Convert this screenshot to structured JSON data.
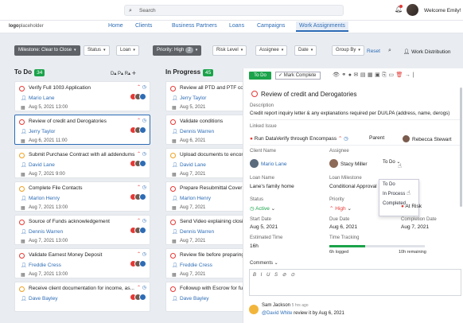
{
  "topbar": {
    "search_placeholder": "Search",
    "welcome": "Welcome Emily!"
  },
  "logo": {
    "brand": "logo",
    "rest": "placeholder"
  },
  "nav": [
    "Home",
    "Clients",
    "Business Partners",
    "Loans",
    "Campaigns",
    "Work Assignments"
  ],
  "filters": {
    "milestone": "Milestone: Clear to Close",
    "status": "Status",
    "loan": "Loan",
    "priority": "Priority: High",
    "priority_count": "2",
    "risk": "Risk Level",
    "assignee": "Assignee",
    "date": "Date",
    "group": "Group By",
    "reset": "Reset",
    "work_dist": "Work Distribution"
  },
  "todo": {
    "title": "To Do",
    "count": "34",
    "sort": "D▴  P▴  R▴"
  },
  "inprogress": {
    "title": "In Progress",
    "count": "45"
  },
  "todo_cards": [
    {
      "title": "Verify Full 1003 Application",
      "user": "Mario Lane",
      "date": "Aug 5, 2021  13:00",
      "ring": "r"
    },
    {
      "title": "Review of credit and Derogatories",
      "user": "Jerry Taylor",
      "date": "Aug 6, 2021  11:00",
      "ring": "r"
    },
    {
      "title": "Submit Purchase Contract with all addendums",
      "user": "David Lane",
      "date": "Aug 7, 2021  9:00",
      "ring": "o"
    },
    {
      "title": "Complete File Contacts",
      "user": "Marlon Henry",
      "date": "Aug 7, 2021  13:00",
      "ring": "o"
    },
    {
      "title": "Source of Funds acknowledgement",
      "user": "Dennis Warren",
      "date": "Aug 7, 2021  13:00",
      "ring": "r"
    },
    {
      "title": "Validate Earnest Money Deposit",
      "user": "Freddie Cress",
      "date": "Aug 7, 2021  13:00",
      "ring": "r"
    },
    {
      "title": "Receive client documentation for income, as...",
      "user": "Dave Bayley",
      "date": "",
      "ring": "o"
    }
  ],
  "progress_cards": [
    {
      "title": "Review all PTD and PTF condi...",
      "user": "Jerry Taylor",
      "date": "Aug 5, 2021",
      "ring": "r"
    },
    {
      "title": "Validate conditions",
      "user": "Dennis Warren",
      "date": "Aug 6, 2021",
      "ring": "r"
    },
    {
      "title": "Upload documents to encomp...",
      "user": "David Lane",
      "date": "Aug 7, 2021",
      "ring": "o"
    },
    {
      "title": "Prepare Resubmittal Cover Le...",
      "user": "Marlon Henry",
      "date": "Aug 7, 2021",
      "ring": "r"
    },
    {
      "title": "Send Video explaining closing...",
      "user": "Dennis Warren",
      "date": "Aug 7, 2021",
      "ring": "r"
    },
    {
      "title": "Review file before preparing...",
      "user": "Freddie Cress",
      "date": "Aug 7, 2021",
      "ring": "r"
    },
    {
      "title": "Followup with Escrow for funding",
      "user": "Dave Bayley",
      "date": "",
      "ring": "r"
    }
  ],
  "panel": {
    "status_btn": "To Do",
    "mark_complete": "Mark Complete",
    "title": "Review of credit and Derogatories",
    "desc_label": "Description",
    "desc": "Credit report inquiry letter & any explanations required per DU/LPA (address, name, derogs)",
    "linked_label": "Linked Issue",
    "linked": "Run DataVerify through Encompass",
    "parent_label": "Parent",
    "parent_user": "Rebecca Stewart",
    "client_label": "Client Name",
    "client": "Mario Lane",
    "assignee_label": "Assignee",
    "assignee": "Stacy Miller",
    "assignee_status": "To Do",
    "loan_label": "Loan Name",
    "loan": "Lane's family home",
    "milestone_label": "Loan Milestone",
    "milestone": "Conditional Approval",
    "status_label": "Status",
    "status": "Active",
    "priority_label": "Priority",
    "priority": "High",
    "risk": "At Risk",
    "start_label": "Start Date",
    "start": "Aug 5, 2021",
    "due_label": "Due Date",
    "due": "Aug 6, 2021",
    "completion_label": "Completion Date",
    "completion": "Aug 7, 2021",
    "est_label": "Estimated Time",
    "est": "16h",
    "tracking_label": "Time Tracking",
    "logged": "6h logged",
    "remaining": "10h remaining",
    "tracking_fraction": 0.375,
    "comments_label": "Comments",
    "editor_tools": "B I U S ⊘ ⊙",
    "dropdown": [
      "To Do",
      "In Process",
      "Completed"
    ],
    "comment_author": "Sam Jackson",
    "comment_time": "5 hrs ago",
    "comment_mention": "@David White",
    "comment_text": "review it by Aug 6, 2021"
  }
}
